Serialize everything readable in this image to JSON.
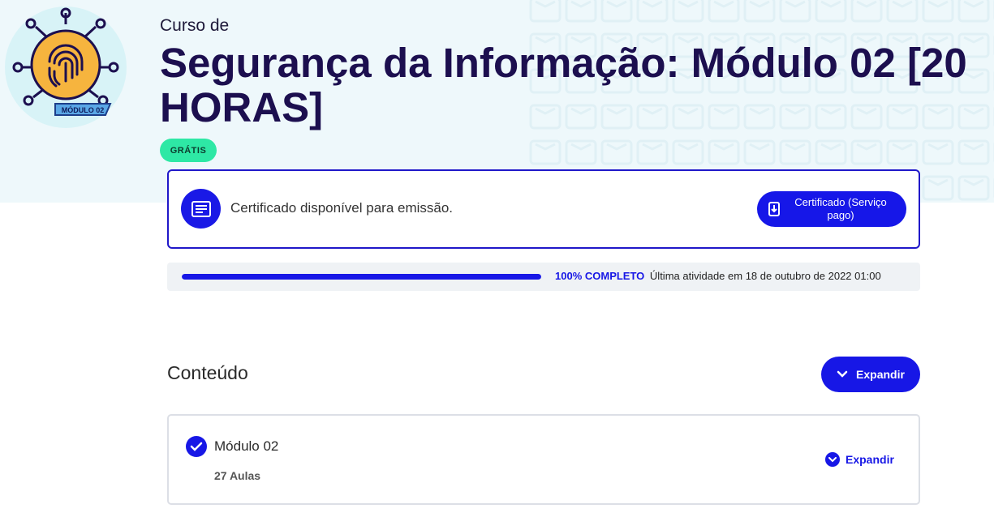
{
  "course": {
    "prefix": "Curso de",
    "title": "Segurança da Informação: Módulo 02 [20 HORAS]",
    "badge": "GRÁTIS",
    "logo_label": "MÓDULO 02"
  },
  "certificate": {
    "message": "Certificado disponível para emissão.",
    "button_label": "Certificado (Serviço pago)"
  },
  "progress": {
    "percent": 100,
    "status": "100% COMPLETO",
    "last_activity": "Última atividade em 18 de outubro de 2022 01:00"
  },
  "content": {
    "heading": "Conteúdo",
    "expand_all_label": "Expandir",
    "modules": [
      {
        "title": "Módulo 02",
        "lessons": "27 Aulas",
        "expand_label": "Expandir",
        "completed": true
      }
    ]
  },
  "colors": {
    "accent": "#1717e6",
    "title": "#1c0f4f",
    "badge": "#2ee8a5",
    "hero_bg": "#eef8fb"
  },
  "icons": [
    "fingerprint-icon",
    "certificate-icon",
    "download-icon",
    "chevron-down-icon",
    "check-icon"
  ]
}
